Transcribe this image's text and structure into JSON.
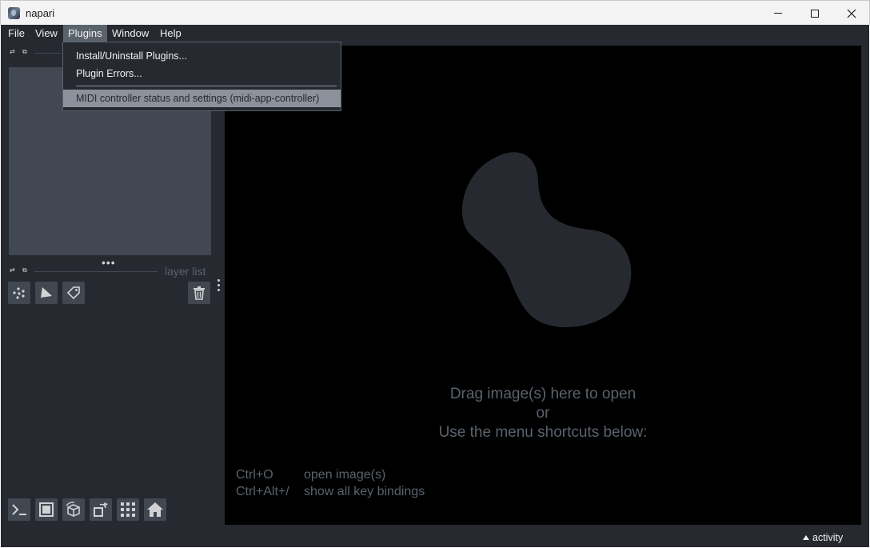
{
  "window": {
    "title": "napari",
    "icons": [
      "napari-app-icon",
      "minimize-icon",
      "maximize-icon",
      "close-icon"
    ]
  },
  "menubar": {
    "items": [
      {
        "label": "File"
      },
      {
        "label": "View"
      },
      {
        "label": "Plugins"
      },
      {
        "label": "Window"
      },
      {
        "label": "Help"
      }
    ],
    "active": "Plugins"
  },
  "plugins_menu": {
    "items": [
      {
        "label": "Install/Uninstall Plugins..."
      },
      {
        "label": "Plugin Errors..."
      },
      {
        "label": "MIDI controller status and settings (midi-app-controller)"
      }
    ],
    "highlighted_item": "MIDI controller status and settings (midi-app-controller)"
  },
  "layer_list": {
    "label": "layer list",
    "buttons": [
      "new-points-layer-icon",
      "new-shapes-layer-icon",
      "new-labels-layer-icon",
      "delete-layer-icon"
    ]
  },
  "viewer_buttons": [
    "console-icon",
    "ndisplay-2d-icon",
    "roll-dims-icon",
    "transpose-icon",
    "grid-icon",
    "home-icon"
  ],
  "welcome": {
    "line1": "Drag image(s) here to open",
    "line2": "or",
    "line3": "Use the menu shortcuts below:",
    "shortcuts": [
      {
        "key": "Ctrl+O",
        "desc": "open image(s)"
      },
      {
        "key": "Ctrl+Alt+/",
        "desc": "show all key bindings"
      }
    ]
  },
  "statusbar": {
    "activity_label": "activity"
  },
  "colors": {
    "background": "#262930",
    "foreground": "#414851",
    "primary": "#5a626c",
    "highlight": "#8b929b",
    "text": "#f0f1f2",
    "canvas": "#000000"
  }
}
